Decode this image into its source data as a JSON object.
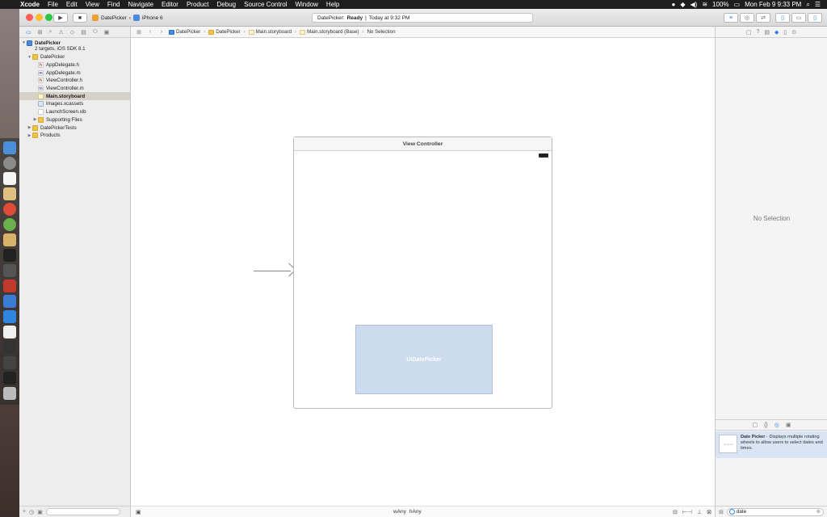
{
  "menubar": {
    "apple": "",
    "app": "Xcode",
    "items": [
      "File",
      "Edit",
      "View",
      "Find",
      "Navigate",
      "Editor",
      "Product",
      "Debug",
      "Source Control",
      "Window",
      "Help"
    ],
    "battery": "100%",
    "datetime": "Mon Feb 9  9:33 PM"
  },
  "toolbar": {
    "run_label": "▶",
    "stop_label": "■",
    "scheme": "DatePicker",
    "device": "iPhone 6",
    "status_app": "DatePicker:",
    "status_state": "Ready",
    "status_sep": "|",
    "status_time": "Today at 9:32 PM"
  },
  "navigator": {
    "project": {
      "name": "DatePicker",
      "subtitle": "2 targets, iOS SDK 8.1"
    },
    "items": [
      {
        "label": "DatePicker",
        "type": "folder",
        "indent": 1,
        "expanded": true
      },
      {
        "label": "AppDelegate.h",
        "type": "h",
        "indent": 2
      },
      {
        "label": "AppDelegate.m",
        "type": "m",
        "indent": 2
      },
      {
        "label": "ViewController.h",
        "type": "h",
        "indent": 2
      },
      {
        "label": "ViewController.m",
        "type": "m",
        "indent": 2
      },
      {
        "label": "Main.storyboard",
        "type": "storyboard",
        "indent": 2,
        "selected": true
      },
      {
        "label": "Images.xcassets",
        "type": "asset",
        "indent": 2
      },
      {
        "label": "LaunchScreen.xib",
        "type": "xib",
        "indent": 2
      },
      {
        "label": "Supporting Files",
        "type": "folder",
        "indent": 2,
        "collapsed": true
      },
      {
        "label": "DatePickerTests",
        "type": "folder",
        "indent": 1,
        "collapsed": true
      },
      {
        "label": "Products",
        "type": "folder",
        "indent": 1,
        "collapsed": true
      }
    ]
  },
  "jumpbar": {
    "crumbs": [
      "DatePicker",
      "DatePicker",
      "Main.storyboard",
      "Main.storyboard (Base)",
      "No Selection"
    ]
  },
  "storyboard": {
    "scene_title": "View Controller",
    "date_picker_label": "UIDatePicker"
  },
  "editor_bottom": {
    "width_class": "Any",
    "height_class": "Any"
  },
  "utilities": {
    "no_selection": "No Selection",
    "library_item": {
      "title": "Date Picker",
      "description": " - Displays multiple rotating wheels to allow users to select dates and times."
    },
    "search_value": "date"
  },
  "colors": {
    "accent": "#2b7fe6",
    "close": "#fc5f57",
    "minimize": "#fdbc2e",
    "zoom": "#28c840",
    "date_picker_fill": "#cddbef"
  }
}
